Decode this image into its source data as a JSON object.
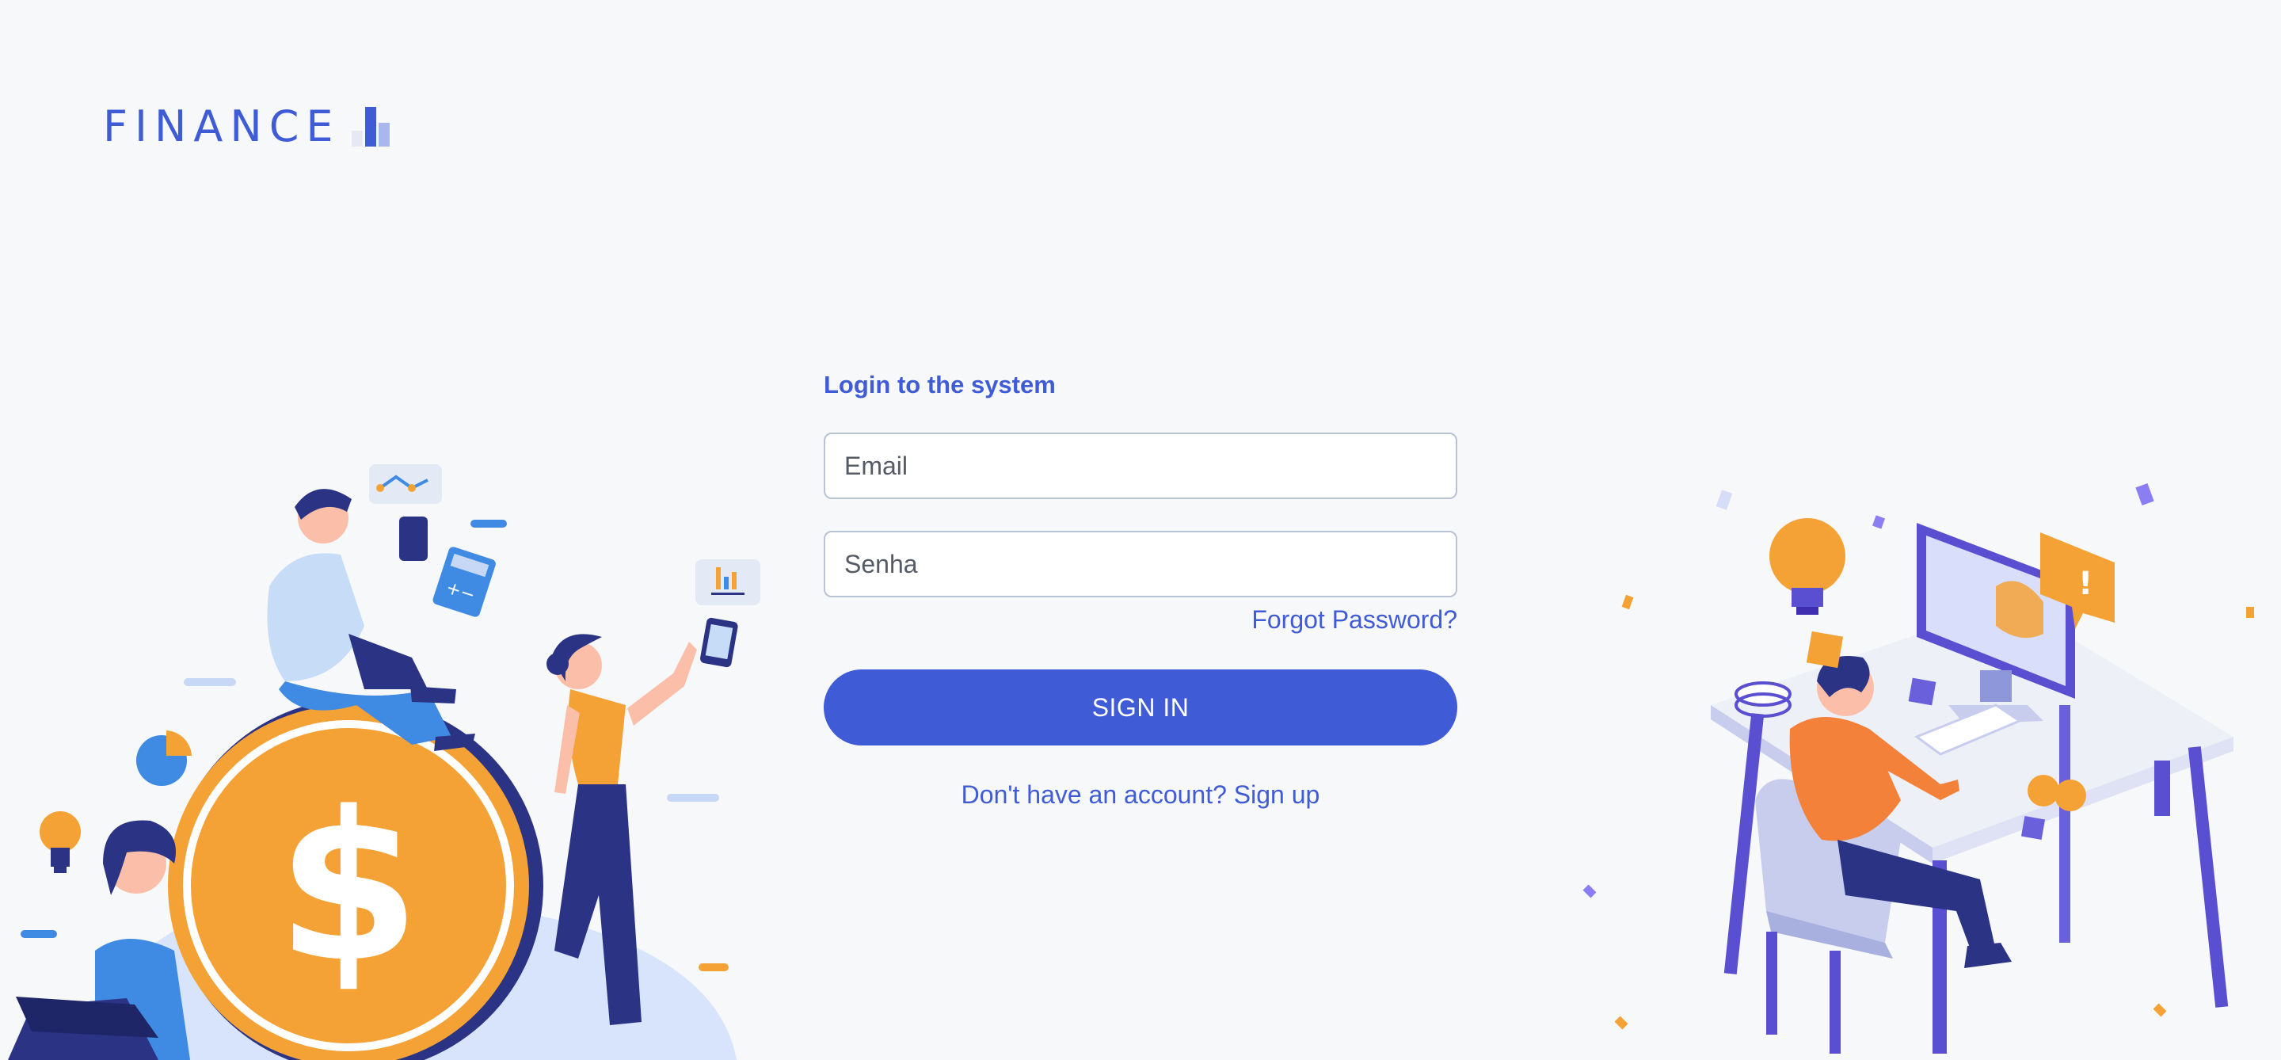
{
  "brand": {
    "name": "FINANCE",
    "logo_icon": "bar-chart-icon"
  },
  "login": {
    "title": "Login to the system",
    "email_placeholder": "Email",
    "password_placeholder": "Senha",
    "forgot_label": "Forgot Password?",
    "signin_label": "SIGN IN",
    "signup_label": "Don't have an account? Sign up"
  },
  "colors": {
    "accent": "#3f5bd6",
    "background": "#f7f8fa",
    "coin": "#f4a236",
    "navy": "#2b3385"
  },
  "illustrations": {
    "left": "finance-people-coin-illustration",
    "right": "person-at-computer-desk-illustration"
  }
}
